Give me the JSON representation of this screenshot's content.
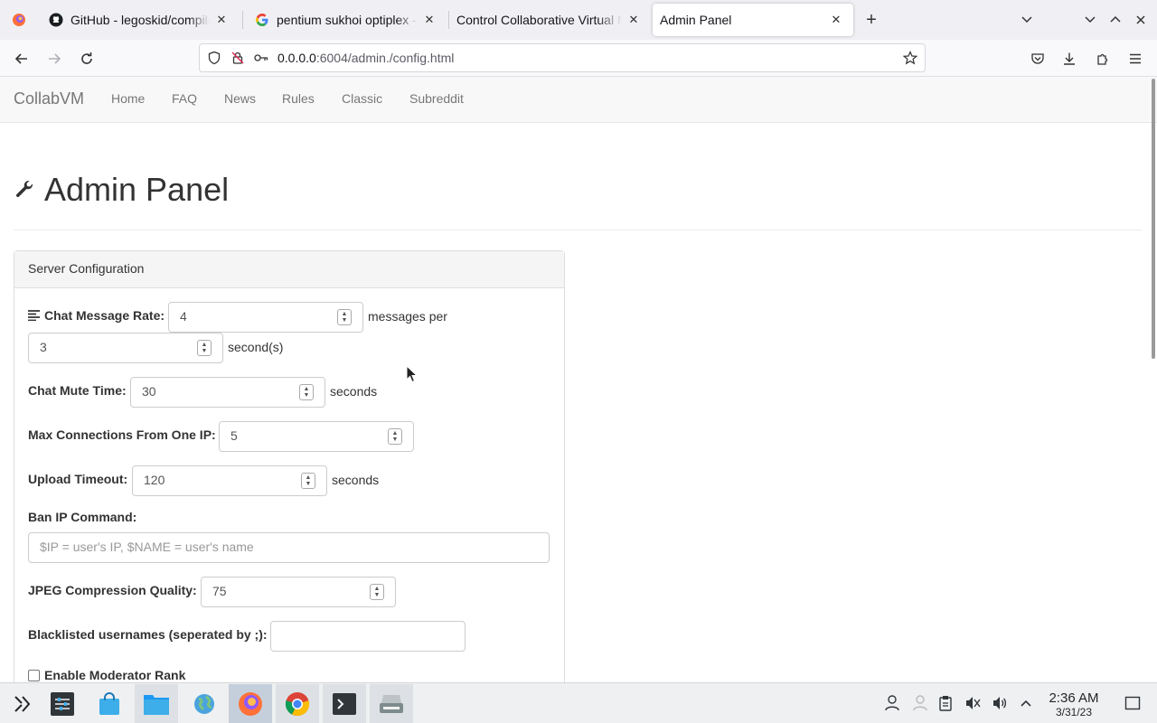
{
  "browser": {
    "tabs": [
      {
        "title": "GitHub - legoskid/compileddmsbindata",
        "icon": "github-icon"
      },
      {
        "title": "pentium sukhoi optiplex - Google Search",
        "icon": "google-icon"
      },
      {
        "title": "Control Collaborative Virtual Machines",
        "icon": "none"
      },
      {
        "title": "Admin Panel",
        "icon": "none",
        "active": true
      }
    ],
    "new_tab_label": "+",
    "url_host": "0.0.0.0",
    "url_path": ":6004/admin./config.html"
  },
  "site": {
    "brand": "CollabVM",
    "nav": [
      "Home",
      "FAQ",
      "News",
      "Rules",
      "Classic",
      "Subreddit"
    ]
  },
  "page": {
    "title": "Admin Panel",
    "panel_heading": "Server Configuration",
    "chat_rate_label": "Chat Message Rate:",
    "chat_rate_messages": "4",
    "chat_rate_mid": "messages per",
    "chat_rate_seconds": "3",
    "chat_rate_suffix": "second(s)",
    "mute_label": "Chat Mute Time:",
    "mute_value": "30",
    "mute_suffix": "seconds",
    "max_conn_label": "Max Connections From One IP:",
    "max_conn_value": "5",
    "upload_label": "Upload Timeout:",
    "upload_value": "120",
    "upload_suffix": "seconds",
    "ban_label": "Ban IP Command:",
    "ban_placeholder": "$IP = user's IP, $NAME = user's name",
    "jpeg_label": "JPEG Compression Quality:",
    "jpeg_value": "75",
    "blacklist_label": "Blacklisted usernames (seperated by ;):",
    "blacklist_value": "",
    "moderator_label": "Enable Moderator Rank"
  },
  "taskbar": {
    "time": "2:36 AM",
    "date": "3/31/23"
  },
  "colors": {
    "tabbar_bg": "#f0f0f4",
    "page_nav_bg": "#f8f8f8",
    "taskbar_bg": "#eff0f1",
    "active_task": "#c5cfdc"
  }
}
